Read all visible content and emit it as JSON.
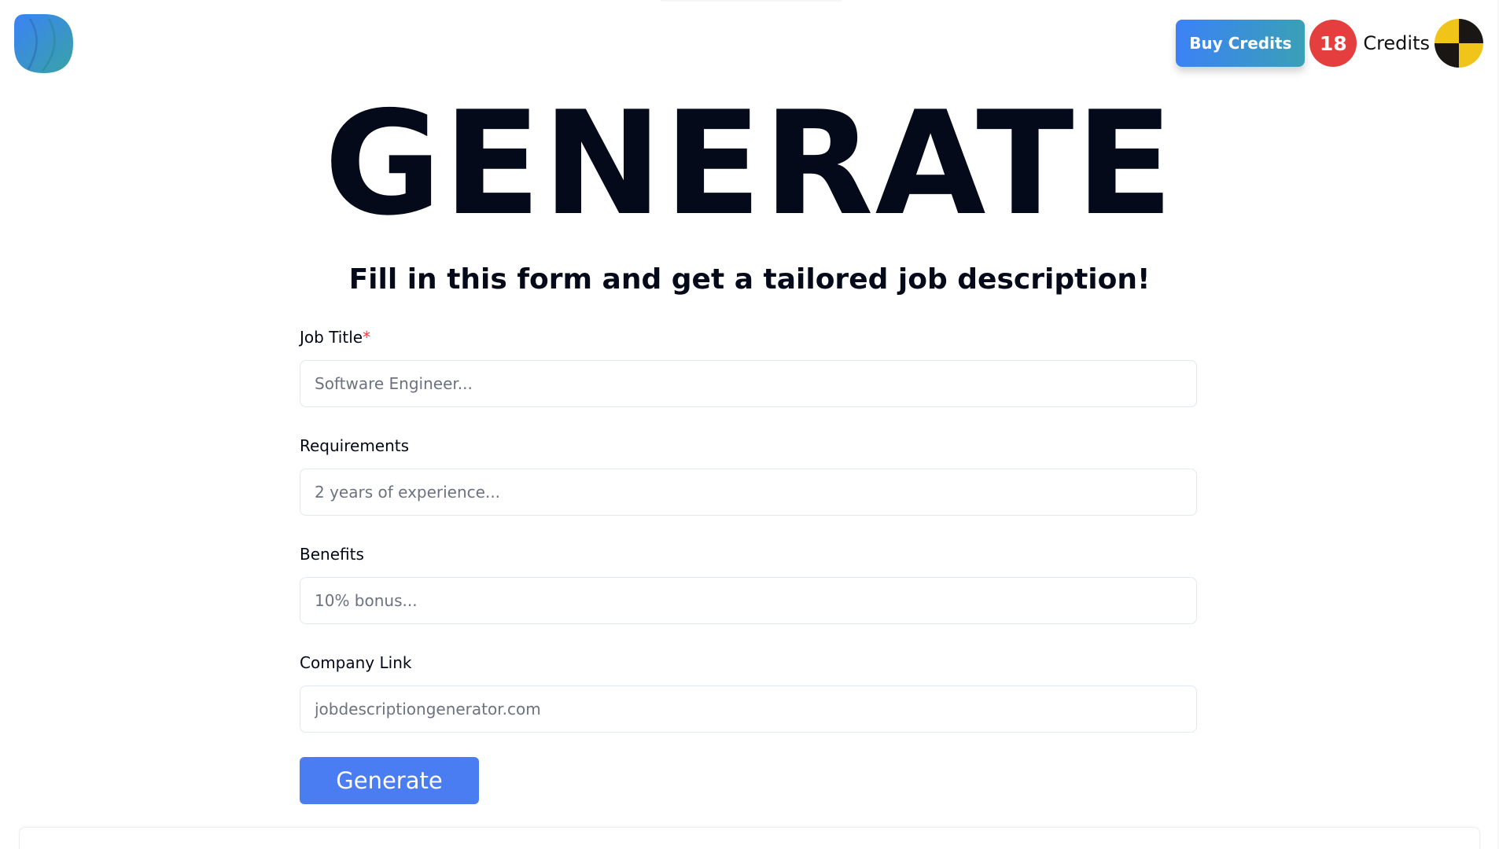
{
  "header": {
    "buy_credits_label": "Buy Credits",
    "credits_count": "18",
    "credits_label": "Credits"
  },
  "hero": {
    "title": "GENERATE",
    "subtitle": "Fill in this form and get a tailored job description!"
  },
  "form": {
    "fields": [
      {
        "label": "Job Title",
        "required_marker": "*",
        "value": "",
        "placeholder": "Software Engineer..."
      },
      {
        "label": "Requirements",
        "value": "",
        "placeholder": "2 years of experience..."
      },
      {
        "label": "Benefits",
        "value": "",
        "placeholder": "10% bonus..."
      },
      {
        "label": "Company Link",
        "value": "",
        "placeholder": "jobdescriptiongenerator.com"
      }
    ],
    "submit_label": "Generate"
  },
  "colors": {
    "primary_button": "#4a7cf2",
    "buy_gradient_start": "#3b82f6",
    "buy_gradient_end": "#3aa0b6",
    "credit_badge": "#e53e3e",
    "required_star": "#e53e3e",
    "heading": "#040a1a"
  },
  "icons": {
    "logo": "app-logo-icon",
    "avatar": "user-avatar-icon"
  }
}
